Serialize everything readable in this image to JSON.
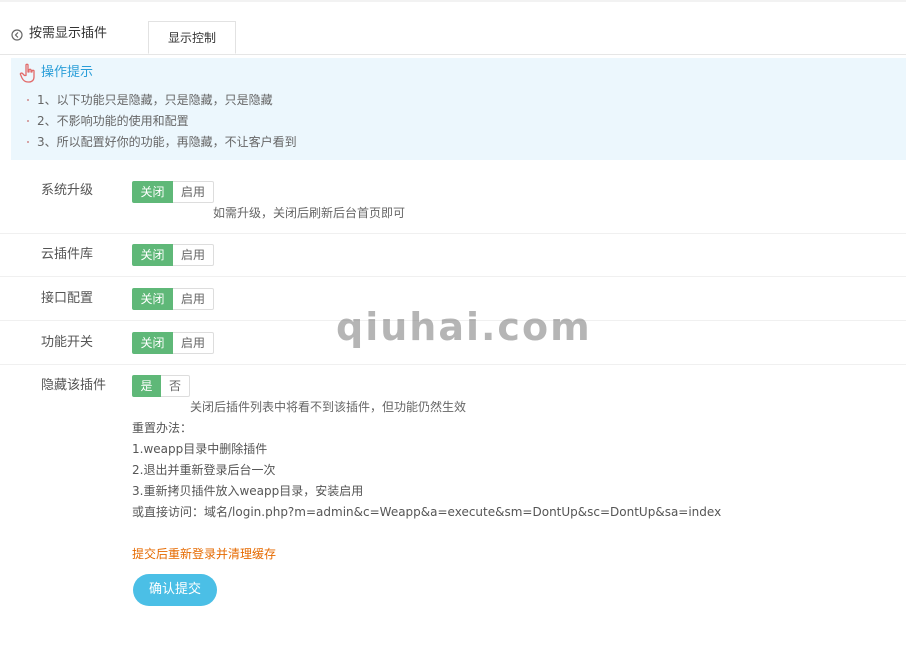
{
  "header": {
    "title": "按需显示插件",
    "tab_label": "显示控制"
  },
  "tips": {
    "title": "操作提示",
    "items": [
      "1、以下功能只是隐藏，只是隐藏，只是隐藏",
      "2、不影响功能的使用和配置",
      "3、所以配置好你的功能，再隐藏，不让客户看到"
    ]
  },
  "rows": [
    {
      "label": "系统升级",
      "on_label": "关闭",
      "off_label": "启用",
      "hint": "如需升级，关闭后刷新后台首页即可"
    },
    {
      "label": "云插件库",
      "on_label": "关闭",
      "off_label": "启用"
    },
    {
      "label": "接口配置",
      "on_label": "关闭",
      "off_label": "启用"
    },
    {
      "label": "功能开关",
      "on_label": "关闭",
      "off_label": "启用"
    }
  ],
  "hide_plugin": {
    "label": "隐藏该插件",
    "on_label": "是",
    "off_label": "否",
    "hint": "关闭后插件列表中将看不到该插件，但功能仍然生效",
    "reset_lines": [
      "重置办法：",
      "1.weapp目录中删除插件",
      "2.退出并重新登录后台一次",
      "3.重新拷贝插件放入weapp目录，安装启用",
      "或直接访问：域名/login.php?m=admin&c=Weapp&a=execute&sm=DontUp&sc=DontUp&sa=index"
    ]
  },
  "warning": "提交后重新登录并清理缓存",
  "submit_label": "确认提交",
  "watermark": "qiuhai.com",
  "colors": {
    "active_toggle": "#5fb878",
    "tips_bg": "#ecf7fd",
    "tips_title": "#2a9ed8",
    "warning": "#e66a00",
    "submit_bg": "#4bbfe6"
  }
}
